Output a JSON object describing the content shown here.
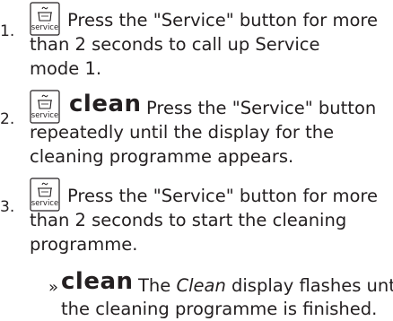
{
  "steps": [
    {
      "number": "1.",
      "icon": "service-button-icon",
      "icon_label": "service",
      "keyword": "",
      "line1": "Press the \"Service\" button for more",
      "line2": "than 2 seconds to call up Service",
      "line3": "mode 1."
    },
    {
      "number": "2.",
      "icon": "service-button-icon",
      "icon_label": "service",
      "keyword": "clean",
      "line1": "Press the \"Service\" button",
      "line2": "repeatedly until the display for the",
      "line3": "cleaning programme appears."
    },
    {
      "number": "3.",
      "icon": "service-button-icon",
      "icon_label": "service",
      "keyword": "",
      "line1": "Press the \"Service\" button for more",
      "line2": "than 2 seconds to start the cleaning",
      "line3": "programme."
    }
  ],
  "result": {
    "marker": "»",
    "keyword": "clean",
    "text_before": "The ",
    "italic_word": "Clean",
    "text_after": " display flashes until",
    "line2": "the cleaning programme is finished."
  }
}
